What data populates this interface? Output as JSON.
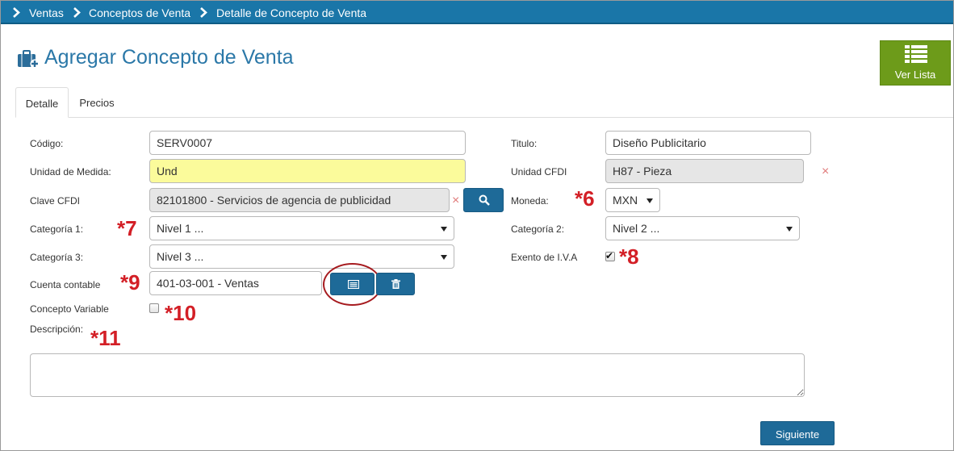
{
  "breadcrumb": {
    "items": [
      "Ventas",
      "Conceptos de Venta",
      "Detalle de Concepto de Venta"
    ]
  },
  "page": {
    "title": "Agregar Concepto de Venta",
    "title_icon": "briefcase-plus-icon"
  },
  "header": {
    "ver_lista_label": "Ver Lista",
    "ver_lista_icon": "list-icon"
  },
  "tabs": [
    {
      "label": "Detalle",
      "active": true
    },
    {
      "label": "Precios",
      "active": false
    }
  ],
  "form": {
    "codigo": {
      "label": "Código:",
      "value": "SERV0007"
    },
    "titulo": {
      "label": "Titulo:",
      "value": "Diseño Publicitario"
    },
    "unidad_medida": {
      "label": "Unidad de Medida:",
      "value": "Und"
    },
    "unidad_cfdi": {
      "label": "Unidad CFDI",
      "value": "H87 - Pieza"
    },
    "clave_cfdi": {
      "label": "Clave CFDI",
      "value": "82101800 - Servicios de agencia de publicidad"
    },
    "moneda": {
      "label": "Moneda:",
      "value": "MXN"
    },
    "categoria1": {
      "label": "Categoría 1:",
      "value": "Nivel 1 ..."
    },
    "categoria2": {
      "label": "Categoría 2:",
      "value": "Nivel 2 ..."
    },
    "categoria3": {
      "label": "Categoría 3:",
      "value": "Nivel 3 ..."
    },
    "exento_iva": {
      "label": "Exento de I.V.A",
      "checked": true
    },
    "cuenta_contable": {
      "label": "Cuenta contable",
      "value": "401-03-001 - Ventas"
    },
    "concepto_variable": {
      "label": "Concepto Variable",
      "checked": false
    },
    "descripcion": {
      "label": "Descripción:",
      "value": ""
    },
    "clear_mark": "×"
  },
  "annotations": {
    "a6": "*6",
    "a7": "*7",
    "a8": "*8",
    "a9": "*9",
    "a10": "*10",
    "a11": "*11"
  },
  "actions": {
    "siguiente_label": "Siguiente"
  },
  "colors": {
    "breadcrumb_bg": "#1a76a8",
    "title": "#2b78a8",
    "ver_lista_bg": "#6d9b1a",
    "button_blue": "#1e6a98",
    "annotation_red": "#d31f26",
    "highlight_field": "#fbfb9b"
  }
}
